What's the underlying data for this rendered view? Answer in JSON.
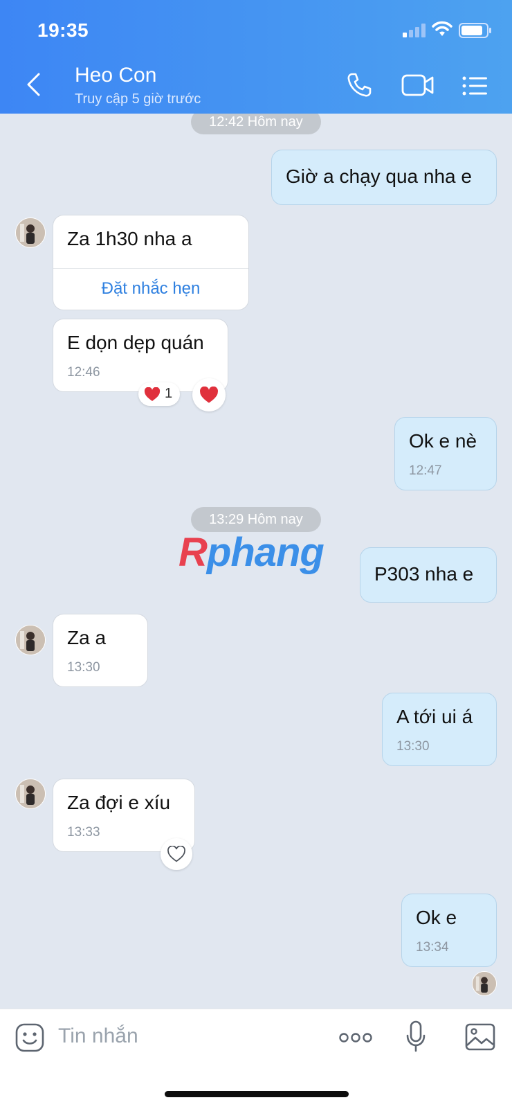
{
  "status_bar": {
    "time": "19:35"
  },
  "header": {
    "contact_name": "Heo Con",
    "last_seen": "Truy cập 5 giờ trước",
    "icons": [
      "back-arrow-icon",
      "phone-icon",
      "video-call-icon",
      "list-menu-icon"
    ]
  },
  "dividers": [
    {
      "label": "12:42 Hôm nay"
    },
    {
      "label": "13:29 Hôm nay"
    }
  ],
  "messages": [
    {
      "sender": "me",
      "text": "Giờ a chạy qua nha e"
    },
    {
      "sender": "them",
      "text": "Za 1h30 nha a",
      "action": "Đặt nhắc hẹn"
    },
    {
      "sender": "them",
      "text": "E dọn dẹp quán",
      "time": "12:46",
      "reaction_count": "1"
    },
    {
      "sender": "me",
      "text": "Ok e nè",
      "time": "12:47"
    },
    {
      "sender": "me",
      "text": "P303 nha e"
    },
    {
      "sender": "them",
      "text": "Za a",
      "time": "13:30"
    },
    {
      "sender": "me",
      "text": "A tới ui á",
      "time": "13:30"
    },
    {
      "sender": "them",
      "text": "Za đợi e xíu",
      "time": "13:33"
    },
    {
      "sender": "me",
      "text": "Ok e",
      "time": "13:34"
    }
  ],
  "watermark": "Rphang",
  "input": {
    "placeholder": "Tin nhắn"
  },
  "colors": {
    "header_start": "#3d86f4",
    "header_end": "#4da2f0",
    "my_bubble": "#d5ecfb",
    "their_bubble": "#ffffff",
    "chat_bg": "#e1e7f0",
    "link": "#2f80e0"
  }
}
